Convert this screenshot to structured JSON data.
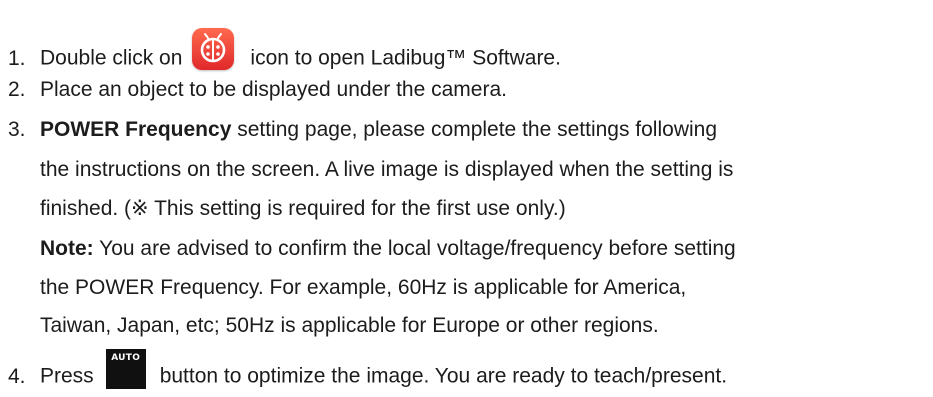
{
  "steps": [
    {
      "number": "1.",
      "before_icon": "Double click on",
      "icon": "ladibug-icon",
      "after_icon": "icon to open Ladibug™ Software."
    },
    {
      "number": "2.",
      "text": "Place an object to be displayed under the camera."
    },
    {
      "number": "3.",
      "bold": "POWER Frequency",
      "text_line1": " setting page, please complete the settings following",
      "text_line2": "the instructions on the screen. A live image is displayed when the setting is",
      "text_line3": "finished. (※ This setting is required for the first use only.)",
      "note_label": "Note:",
      "note_line1": " You are advised to confirm the local voltage/frequency before setting",
      "note_line2": "the POWER Frequency. For example, 60Hz is applicable for America,",
      "note_line3": "Taiwan, Japan, etc; 50Hz is applicable for Europe or other regions."
    },
    {
      "number": "4.",
      "before_icon": "Press",
      "icon": "auto-button-icon",
      "icon_label": "AUTO",
      "after_icon": "button to optimize the image. You are ready to teach/present."
    }
  ]
}
